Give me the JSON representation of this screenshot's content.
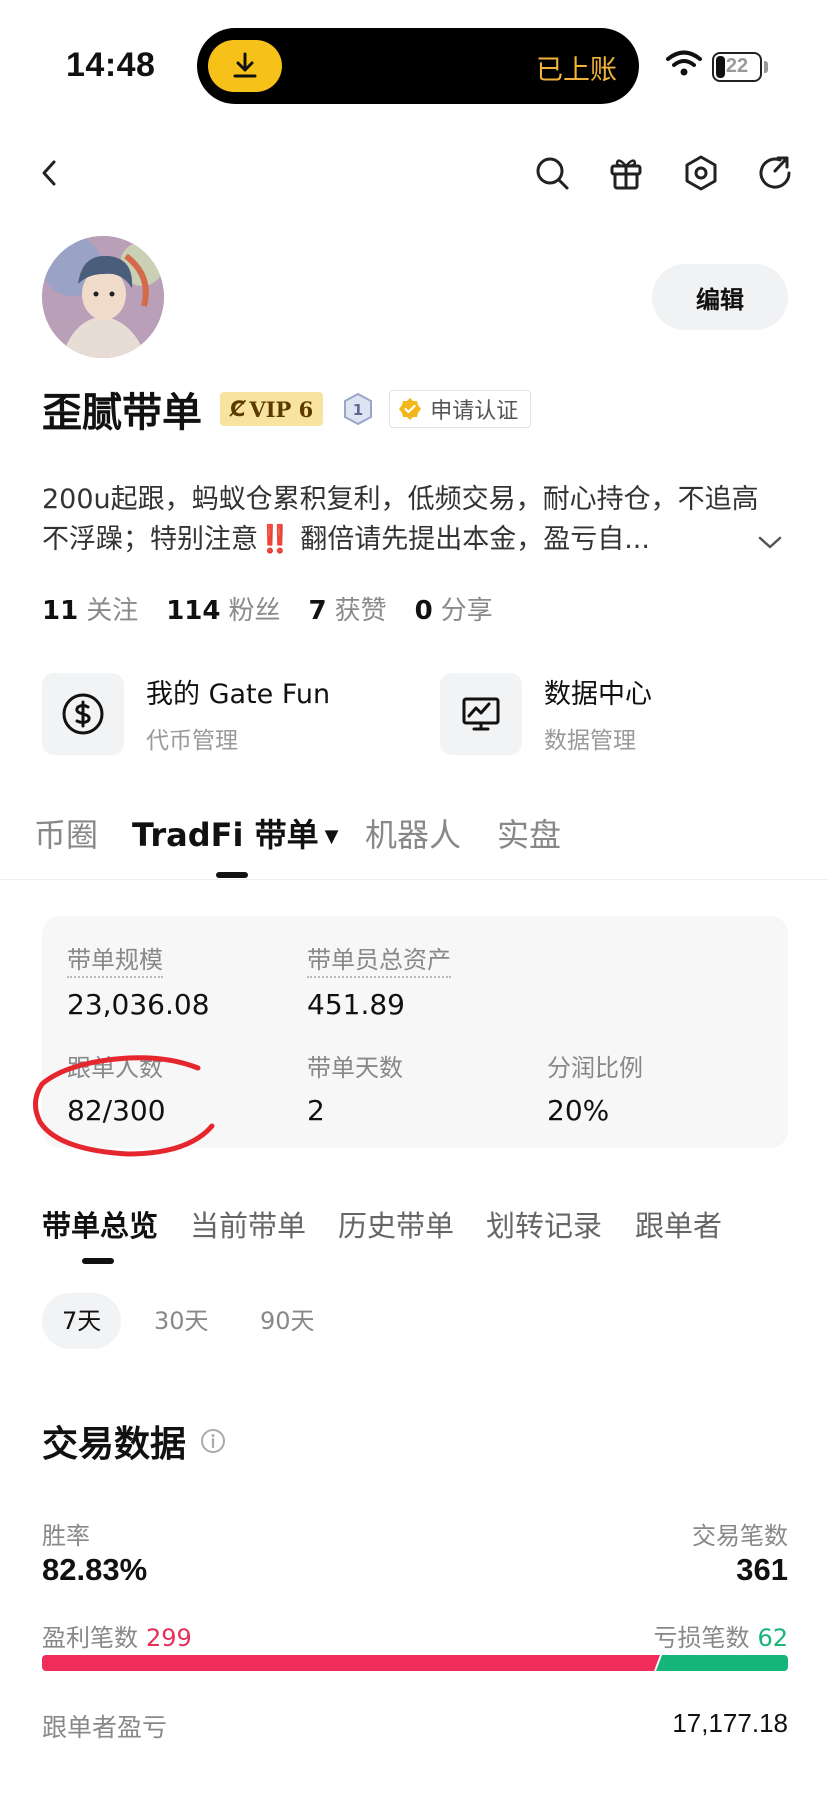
{
  "status_bar": {
    "time": "14:48",
    "island_text": "已上账",
    "battery": "22"
  },
  "icons": {
    "back": "chevron-left-icon",
    "search": "search-icon",
    "gift": "gift-icon",
    "settings": "gear-icon",
    "share": "share-icon"
  },
  "profile": {
    "name": "歪腻带单",
    "vip": "VIP 6",
    "level": "1",
    "certify": "申请认证",
    "edit_label": "编辑",
    "bio": "200u起跟，蚂蚁仓累积复利，低频交易，耐心持仓，不追高不浮躁；特别注意‼️ 翻倍请先提出本金，盈亏自...",
    "stats": [
      {
        "value": "11",
        "label": "关注"
      },
      {
        "value": "114",
        "label": "粉丝"
      },
      {
        "value": "7",
        "label": "获赞"
      },
      {
        "value": "0",
        "label": "分享"
      }
    ]
  },
  "shortcuts": [
    {
      "title": "我的 Gate Fun",
      "subtitle": "代币管理",
      "icon": "dollar-coin-icon"
    },
    {
      "title": "数据中心",
      "subtitle": "数据管理",
      "icon": "monitor-chart-icon"
    }
  ],
  "main_tabs": [
    "币圈",
    "TradFi 带单",
    "机器人",
    "实盘"
  ],
  "summary": {
    "scale_label": "带单规模",
    "scale_value": "23,036.08",
    "assets_label": "带单员总资产",
    "assets_value": "451.89",
    "followers_label": "跟单人数",
    "followers_value": "82/300",
    "days_label": "带单天数",
    "days_value": "2",
    "share_label": "分润比例",
    "share_value": "20%"
  },
  "sub_tabs": [
    "带单总览",
    "当前带单",
    "历史带单",
    "划转记录",
    "跟单者"
  ],
  "ranges": [
    "7天",
    "30天",
    "90天"
  ],
  "trading": {
    "title": "交易数据",
    "win_rate_label": "胜率",
    "win_rate": "82.83%",
    "trades_label": "交易笔数",
    "trades": "361",
    "profit_label": "盈利笔数",
    "profit_count": "299",
    "loss_label": "亏损笔数",
    "loss_count": "62",
    "win_fraction": 0.8283,
    "follower_pnl_label": "跟单者盈亏",
    "follower_pnl": "17,177.18"
  },
  "colors": {
    "profit": "#ef2c5a",
    "loss": "#16b57a",
    "vip_bg": "#f9e3a0",
    "island_text": "#f0b43a",
    "annotation": "#e5262d"
  }
}
